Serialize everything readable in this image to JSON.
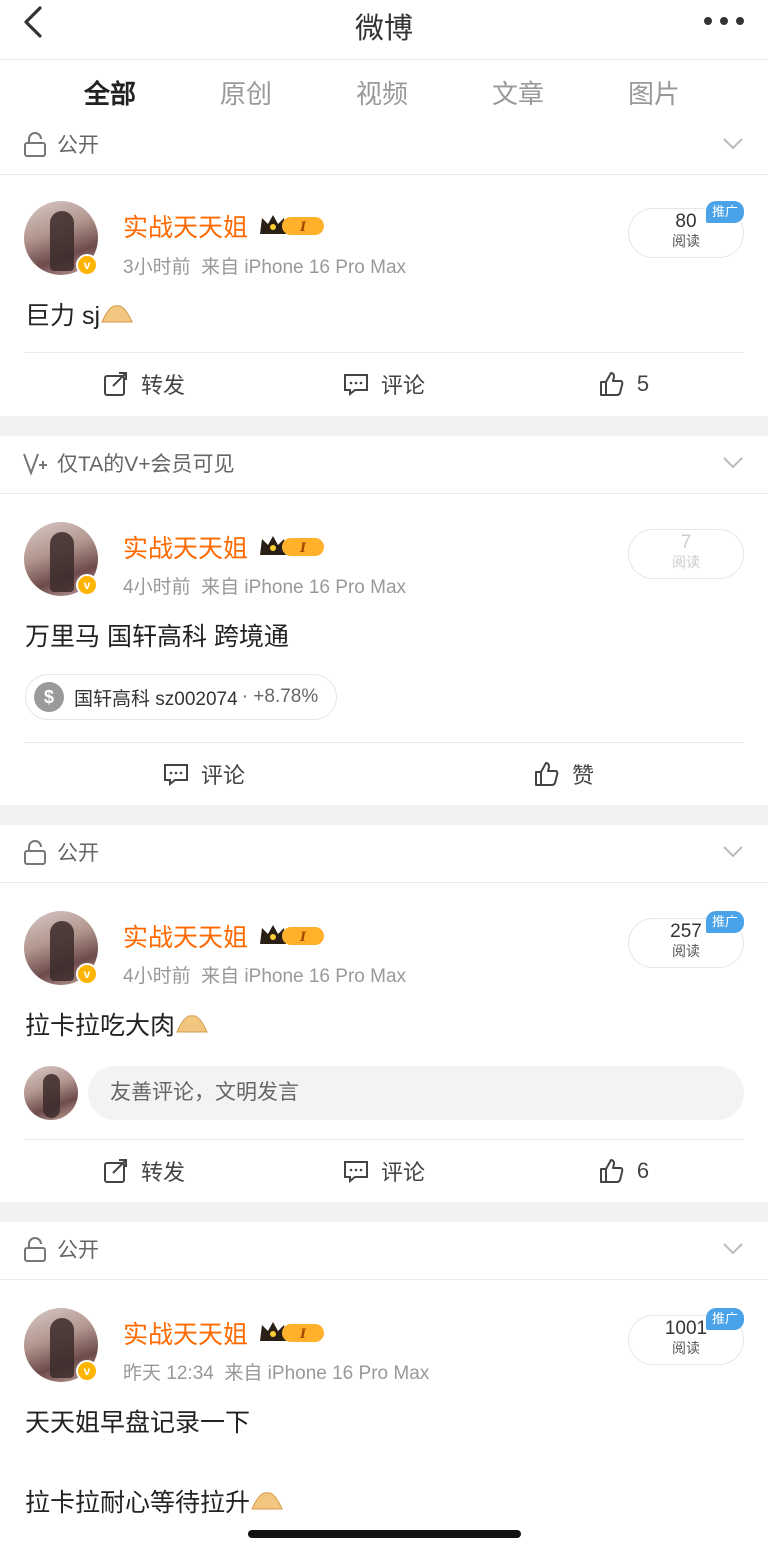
{
  "header": {
    "title": "微博"
  },
  "tabs": [
    {
      "label": "全部"
    },
    {
      "label": "原创"
    },
    {
      "label": "视频"
    },
    {
      "label": "文章"
    },
    {
      "label": "图片"
    }
  ],
  "colors": {
    "accent": "#ff8200",
    "username": "#ff6a00",
    "promo": "#4aa3e8"
  },
  "posts": [
    {
      "visibility": "公开",
      "visibility_icon": "lock-icon",
      "username": "实战天天姐",
      "time": "3小时前",
      "source": "来自 iPhone 16 Pro Max",
      "reads_count": "80",
      "reads_label": "阅读",
      "promo": "推广",
      "text": "巨力 sj",
      "repost": "转发",
      "comment": "评论",
      "likes": "5"
    },
    {
      "visibility": "仅TA的V+会员可见",
      "visibility_icon": "vplus-icon",
      "username": "实战天天姐",
      "time": "4小时前",
      "source": "来自 iPhone 16 Pro Max",
      "reads_count": "7",
      "reads_label": "阅读",
      "text": "万里马  国轩高科 跨境通",
      "stock": {
        "name": "国轩高科 sz002074",
        "change": "· +8.78%"
      },
      "comment": "评论",
      "like_label": "赞"
    },
    {
      "visibility": "公开",
      "visibility_icon": "lock-icon",
      "username": "实战天天姐",
      "time": "4小时前",
      "source": "来自 iPhone 16 Pro Max",
      "reads_count": "257",
      "reads_label": "阅读",
      "promo": "推广",
      "text": "拉卡拉吃大肉",
      "comment_placeholder": "友善评论，文明发言",
      "repost": "转发",
      "comment": "评论",
      "likes": "6"
    },
    {
      "visibility": "公开",
      "visibility_icon": "lock-icon",
      "username": "实战天天姐",
      "time": "昨天 12:34",
      "source": "来自 iPhone 16 Pro Max",
      "reads_count": "1001",
      "reads_label": "阅读",
      "promo": "推广",
      "text_line1": "天天姐早盘记录一下",
      "text_line2": "拉卡拉耐心等待拉升"
    }
  ]
}
